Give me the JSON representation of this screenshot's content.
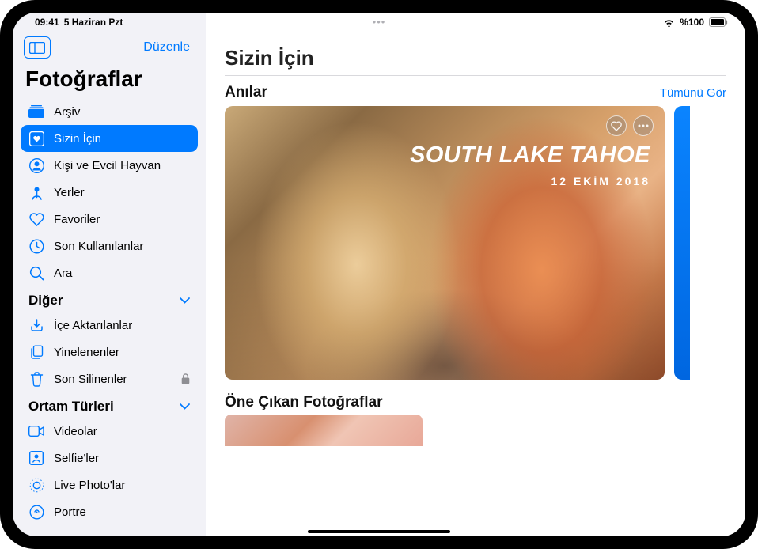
{
  "status": {
    "time": "09:41",
    "date": "5 Haziran Pzt",
    "battery": "%100"
  },
  "sidebar": {
    "edit": "Düzenle",
    "title": "Fotoğraflar",
    "items": [
      {
        "icon": "library-icon",
        "label": "Arşiv"
      },
      {
        "icon": "for-you-icon",
        "label": "Sizin İçin",
        "selected": true
      },
      {
        "icon": "people-icon",
        "label": "Kişi ve Evcil Hayvan"
      },
      {
        "icon": "places-icon",
        "label": "Yerler"
      },
      {
        "icon": "heart-icon",
        "label": "Favoriler"
      },
      {
        "icon": "clock-icon",
        "label": "Son Kullanılanlar"
      },
      {
        "icon": "search-icon",
        "label": "Ara"
      }
    ],
    "sections": [
      {
        "header": "Diğer",
        "items": [
          {
            "icon": "import-icon",
            "label": "İçe Aktarılanlar"
          },
          {
            "icon": "duplicate-icon",
            "label": "Yinelenenler"
          },
          {
            "icon": "trash-icon",
            "label": "Son Silinenler",
            "locked": true
          }
        ]
      },
      {
        "header": "Ortam Türleri",
        "items": [
          {
            "icon": "video-icon",
            "label": "Videolar"
          },
          {
            "icon": "selfie-icon",
            "label": "Selfie'ler"
          },
          {
            "icon": "livephoto-icon",
            "label": "Live Photo'lar"
          },
          {
            "icon": "portrait-icon",
            "label": "Portre"
          }
        ]
      }
    ]
  },
  "main": {
    "title": "Sizin İçin",
    "memories": {
      "header": "Anılar",
      "see_all": "Tümünü Gör",
      "card": {
        "title": "SOUTH LAKE TAHOE",
        "date": "12 EKİM 2018"
      }
    },
    "featured": {
      "header": "Öne Çıkan Fotoğraflar"
    }
  }
}
